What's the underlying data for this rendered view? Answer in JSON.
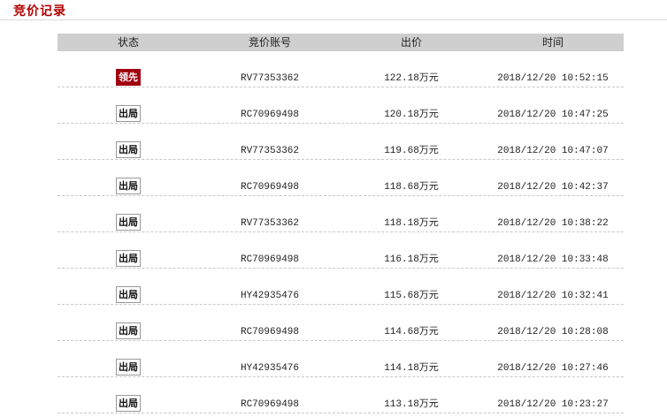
{
  "section": {
    "title": "竞价记录"
  },
  "table": {
    "headers": [
      "状态",
      "竞价账号",
      "出价",
      "时间"
    ],
    "rows": [
      {
        "status": "领先",
        "lead": true,
        "account": "RV77353362",
        "price": "122.18万元",
        "time": "2018/12/20 10:52:15"
      },
      {
        "status": "出局",
        "lead": false,
        "account": "RC70969498",
        "price": "120.18万元",
        "time": "2018/12/20 10:47:25"
      },
      {
        "status": "出局",
        "lead": false,
        "account": "RV77353362",
        "price": "119.68万元",
        "time": "2018/12/20 10:47:07"
      },
      {
        "status": "出局",
        "lead": false,
        "account": "RC70969498",
        "price": "118.68万元",
        "time": "2018/12/20 10:42:37"
      },
      {
        "status": "出局",
        "lead": false,
        "account": "RV77353362",
        "price": "118.18万元",
        "time": "2018/12/20 10:38:22"
      },
      {
        "status": "出局",
        "lead": false,
        "account": "RC70969498",
        "price": "116.18万元",
        "time": "2018/12/20 10:33:48"
      },
      {
        "status": "出局",
        "lead": false,
        "account": "HY42935476",
        "price": "115.68万元",
        "time": "2018/12/20 10:32:41"
      },
      {
        "status": "出局",
        "lead": false,
        "account": "RC70969498",
        "price": "114.68万元",
        "time": "2018/12/20 10:28:08"
      },
      {
        "status": "出局",
        "lead": false,
        "account": "HY42935476",
        "price": "114.18万元",
        "time": "2018/12/20 10:27:46"
      },
      {
        "status": "出局",
        "lead": false,
        "account": "RC70969498",
        "price": "113.18万元",
        "time": "2018/12/20 10:23:27"
      }
    ]
  },
  "colors": {
    "title": "#b10000",
    "lead_badge": "#a0000f",
    "header_bg": "#cfcfcf"
  }
}
